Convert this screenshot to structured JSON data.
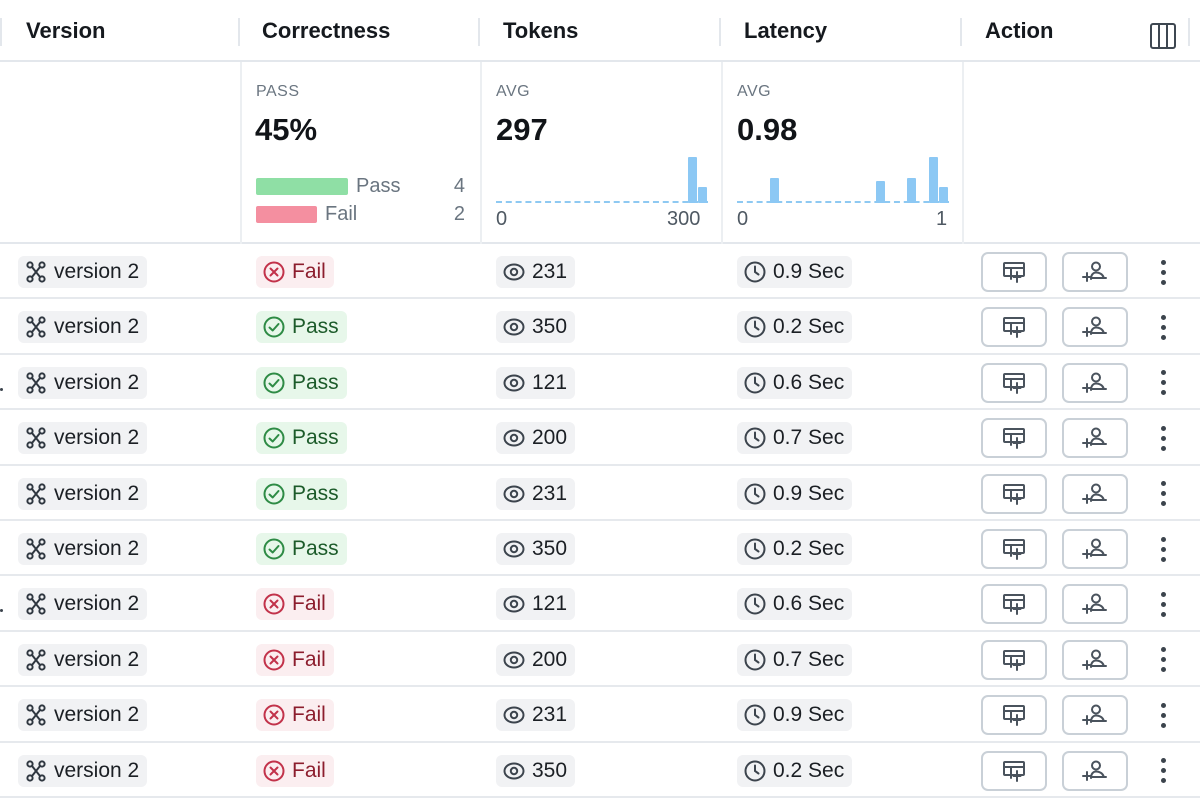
{
  "header": {
    "columns": [
      "Version",
      "Correctness",
      "Tokens",
      "Latency",
      "Action"
    ],
    "column_picker_icon": "columns-icon"
  },
  "summary": {
    "correctness": {
      "label": "PASS",
      "value": "45%",
      "legend": [
        {
          "name": "Pass",
          "count": "4",
          "color": "#8fdfa5"
        },
        {
          "name": "Fail",
          "count": "2",
          "color": "#f48fa0"
        }
      ]
    },
    "tokens": {
      "label": "AVG",
      "value": "297",
      "axis_min": "0",
      "axis_max": "300",
      "histogram": [
        0,
        0,
        0,
        0,
        0,
        0,
        0,
        0,
        0,
        0,
        0,
        0,
        0,
        0,
        0,
        0,
        0,
        0,
        0,
        1,
        0.34
      ]
    },
    "latency": {
      "label": "AVG",
      "value": "0.98",
      "axis_min": "0",
      "axis_max": "1",
      "histogram": [
        0,
        0,
        0,
        0.55,
        0,
        0,
        0,
        0,
        0,
        0,
        0,
        0,
        0,
        0.48,
        0,
        0,
        0.55,
        0,
        1,
        0.34
      ]
    }
  },
  "rows": [
    {
      "version": "version 2",
      "status": "Fail",
      "tokens": "231",
      "latency": "0.9 Sec"
    },
    {
      "version": "version 2",
      "status": "Pass",
      "tokens": "350",
      "latency": "0.2 Sec"
    },
    {
      "version": "version 2",
      "status": "Pass",
      "tokens": "121",
      "latency": "0.6 Sec"
    },
    {
      "version": "version 2",
      "status": "Pass",
      "tokens": "200",
      "latency": "0.7 Sec"
    },
    {
      "version": "version 2",
      "status": "Pass",
      "tokens": "231",
      "latency": "0.9 Sec"
    },
    {
      "version": "version 2",
      "status": "Pass",
      "tokens": "350",
      "latency": "0.2 Sec"
    },
    {
      "version": "version 2",
      "status": "Fail",
      "tokens": "121",
      "latency": "0.6 Sec"
    },
    {
      "version": "version 2",
      "status": "Fail",
      "tokens": "200",
      "latency": "0.7 Sec"
    },
    {
      "version": "version 2",
      "status": "Fail",
      "tokens": "231",
      "latency": "0.9 Sec"
    },
    {
      "version": "version 2",
      "status": "Fail",
      "tokens": "350",
      "latency": "0.2 Sec"
    }
  ],
  "icons": {
    "version": "version-icon",
    "pass": "check-circle-icon",
    "fail": "x-circle-icon",
    "tokens": "eye-icon",
    "latency": "clock-icon",
    "action_1": "add-to-dataset-icon",
    "action_2": "assign-user-icon",
    "more": "more-vertical-icon"
  },
  "colors": {
    "pass_bg": "#e7f7ea",
    "pass_fg": "#1c5b2a",
    "fail_bg": "#fbeef0",
    "fail_fg": "#8c1d2d",
    "histogram": "#8cc8f4"
  }
}
